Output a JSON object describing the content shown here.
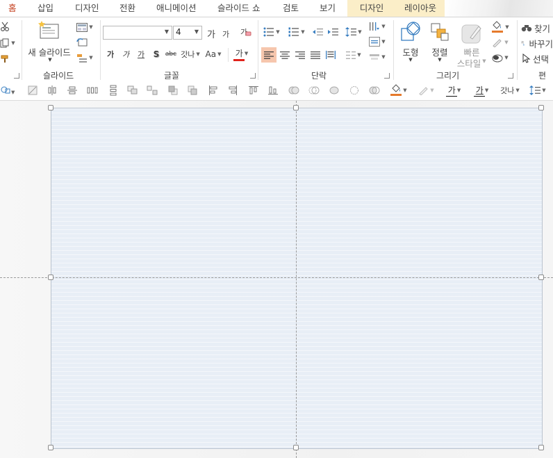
{
  "tabs": [
    {
      "label": "홈",
      "active": true,
      "contextual": false
    },
    {
      "label": "삽입",
      "active": false,
      "contextual": false
    },
    {
      "label": "디자인",
      "active": false,
      "contextual": false
    },
    {
      "label": "전환",
      "active": false,
      "contextual": false
    },
    {
      "label": "애니메이션",
      "active": false,
      "contextual": false
    },
    {
      "label": "슬라이드 쇼",
      "active": false,
      "contextual": false
    },
    {
      "label": "검토",
      "active": false,
      "contextual": false
    },
    {
      "label": "보기",
      "active": false,
      "contextual": false
    },
    {
      "label": "디자인",
      "active": false,
      "contextual": true
    },
    {
      "label": "레이아웃",
      "active": false,
      "contextual": true
    }
  ],
  "ribbon": {
    "slides_group": {
      "label": "슬라이드",
      "new_slide": "새 슬라이드"
    },
    "font_group": {
      "label": "글꼴",
      "font_name": "",
      "font_size": "4",
      "increase_size": "가",
      "decrease_size": "가",
      "clear_format": "가",
      "bold": "가",
      "italic": "가",
      "underline": "가",
      "shadow": "S",
      "strike": "abc",
      "spacing": "갓나",
      "case": "Aa",
      "font_color": "가"
    },
    "paragraph_group": {
      "label": "단락"
    },
    "drawing_group": {
      "label": "그리기",
      "shapes": "도형",
      "arrange": "정렬",
      "quick_styles_line1": "빠른",
      "quick_styles_line2": "스타일"
    },
    "editing_group": {
      "label": "편집",
      "find": "찾기",
      "replace": "바꾸기",
      "select": "선택"
    }
  },
  "arrange_toolbar": {
    "font_color_a": "가",
    "font_color_b": "가",
    "spacing": "갓나"
  },
  "colors": {
    "accent": "#c43e1c",
    "font_color_red": "#e0231c",
    "fill_orange": "#e57a2c",
    "align_left_active": "#f6c6ad",
    "slide_fill": "#e8eef6"
  }
}
